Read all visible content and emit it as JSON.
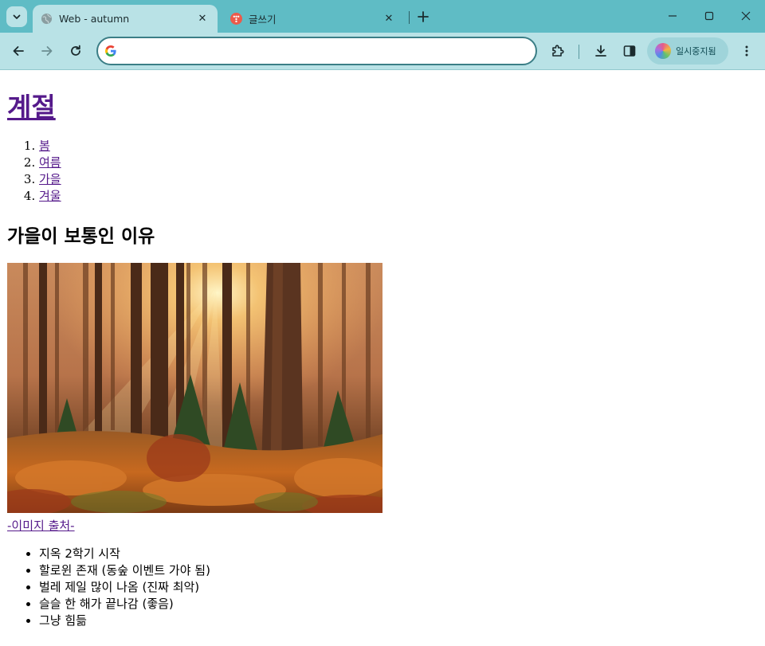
{
  "browser": {
    "tabs": [
      {
        "title": "Web - autumn",
        "active": true
      },
      {
        "title": "글쓰기",
        "active": false
      }
    ],
    "address": {
      "value": "",
      "placeholder": ""
    },
    "profile_label": "일시중지됨"
  },
  "page": {
    "heading": "계절",
    "nav_items": [
      "봄",
      "여름",
      "가을",
      "겨울"
    ],
    "subheading": "가을이 보통인 이유",
    "image_source_link": "-이미지 출처-",
    "reasons": [
      "지옥 2학기 시작",
      "할로윈 존재 (동숲 이벤트 가야 됨)",
      "벌레 제일 많이 나옴 (진짜 최악)",
      "슬슬 한 해가 끝나감 (좋음)",
      "그냥 힘듦"
    ]
  },
  "colors": {
    "chrome_accent": "#5fbcc5",
    "toolbar_bg": "#b9e2e6",
    "visited_link": "#551a8b"
  },
  "icons": {
    "tab_search": "chevron-down-icon",
    "back": "arrow-left-icon",
    "forward": "arrow-right-icon",
    "reload": "reload-icon",
    "search_engine": "google-g-icon",
    "extensions": "puzzle-icon",
    "downloads": "download-icon",
    "side_panel": "side-panel-icon",
    "menu": "more-vertical-icon"
  }
}
